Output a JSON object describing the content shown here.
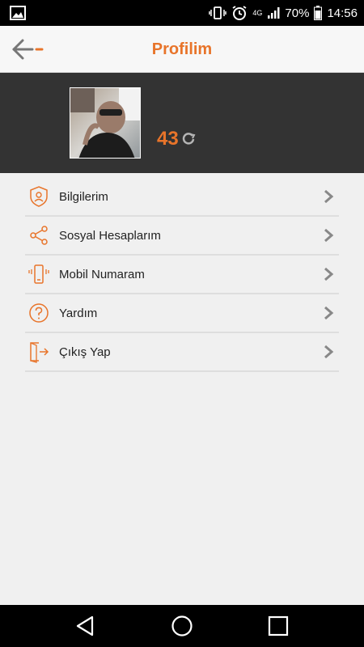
{
  "status": {
    "battery": "70%",
    "time": "14:56",
    "network": "4G"
  },
  "appbar": {
    "title": "Profilim",
    "back_icon": "arrow-left-icon"
  },
  "profile": {
    "score": "43",
    "score_icon": "refresh-icon"
  },
  "menu": {
    "items": [
      {
        "label": "Bilgilerim",
        "icon": "user-shield-icon"
      },
      {
        "label": "Sosyal Hesaplarım",
        "icon": "share-icon"
      },
      {
        "label": "Mobil Numaram",
        "icon": "phone-icon"
      },
      {
        "label": "Yardım",
        "icon": "help-icon"
      },
      {
        "label": "Çıkış Yap",
        "icon": "logout-icon"
      }
    ]
  },
  "colors": {
    "accent": "#e8742a",
    "header_bg": "#333333",
    "background": "#f0f0f0"
  }
}
